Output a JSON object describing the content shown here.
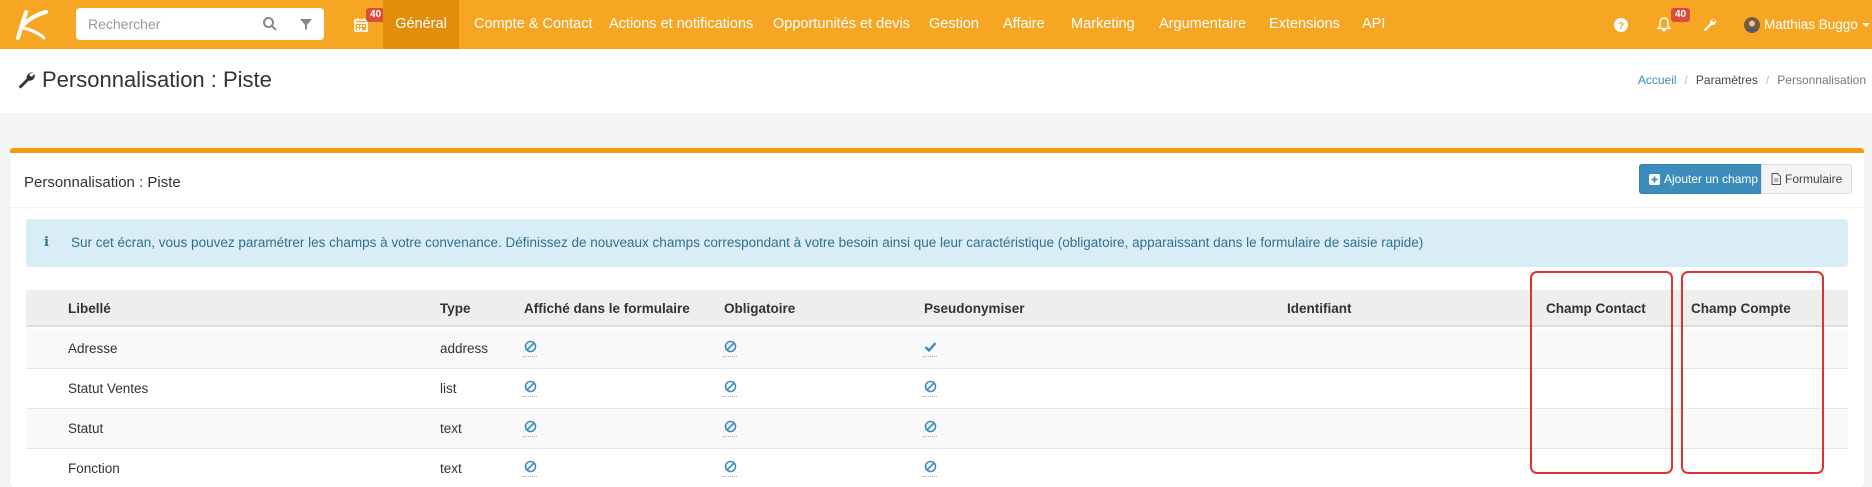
{
  "topbar": {
    "search_placeholder": "Rechercher",
    "calendar_badge": "40",
    "nav": [
      "Général",
      "Compte & Contact",
      "Actions et notifications",
      "Opportunités et devis",
      "Gestion",
      "Affaire",
      "Marketing",
      "Argumentaire",
      "Extensions",
      "API"
    ],
    "active_nav": "Général",
    "notif_badge": "40",
    "user_name": "Matthias Buggo"
  },
  "page": {
    "title": "Personnalisation : Piste",
    "breadcrumb": [
      "Accueil",
      "Paramètres",
      "Personnalisation"
    ]
  },
  "box": {
    "title": "Personnalisation : Piste",
    "add_button": "Ajouter un champ",
    "form_button": "Formulaire",
    "info_text": "Sur cet écran, vous pouvez paramétrer les champs à votre convenance. Définissez de nouveaux champs correspondant à votre besoin ainsi que leur caractéristique (obligatoire, apparaissant dans le formulaire de saisie rapide)"
  },
  "table": {
    "headers": [
      "Libellé",
      "Type",
      "Affiché dans le formulaire",
      "Obligatoire",
      "Pseudonymiser",
      "Identifiant",
      "Champ Contact",
      "Champ Compte"
    ],
    "rows": [
      {
        "label": "Adresse",
        "type": "address",
        "form": "no",
        "required": "no",
        "pseudo": "yes"
      },
      {
        "label": "Statut Ventes",
        "type": "list",
        "form": "no",
        "required": "no",
        "pseudo": "no"
      },
      {
        "label": "Statut",
        "type": "text",
        "form": "no",
        "required": "no",
        "pseudo": "no"
      },
      {
        "label": "Fonction",
        "type": "text",
        "form": "no",
        "required": "no",
        "pseudo": "no"
      }
    ]
  },
  "colors": {
    "topbar": "#f6a623",
    "active_nav": "#e08e0b",
    "primary": "#3c8dbc",
    "info_bg": "#d9edf7",
    "highlight": "#e0332f"
  }
}
